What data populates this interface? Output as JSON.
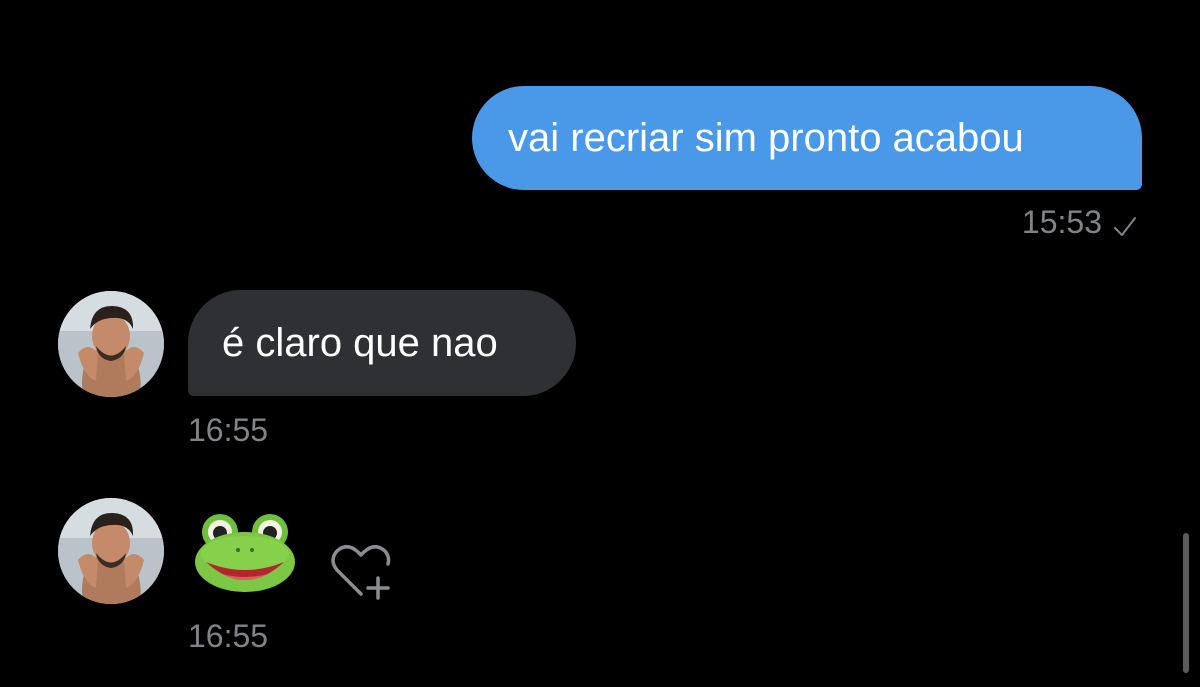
{
  "messages": [
    {
      "direction": "outgoing",
      "text": "vai recriar sim pronto acabou",
      "time": "15:53",
      "status_icon": "check-icon"
    },
    {
      "direction": "incoming",
      "text": "é claro que nao",
      "time": "16:55",
      "avatar_icon": "avatar"
    },
    {
      "direction": "incoming",
      "emoji": "frog-face-emoji",
      "time": "16:55",
      "reaction_icon": "heart-plus-icon"
    }
  ],
  "colors": {
    "background": "#000000",
    "outgoing_bubble": "#4a98e8",
    "incoming_bubble": "#2f3033",
    "timestamp": "#808489",
    "message_text": "#ffffff"
  }
}
